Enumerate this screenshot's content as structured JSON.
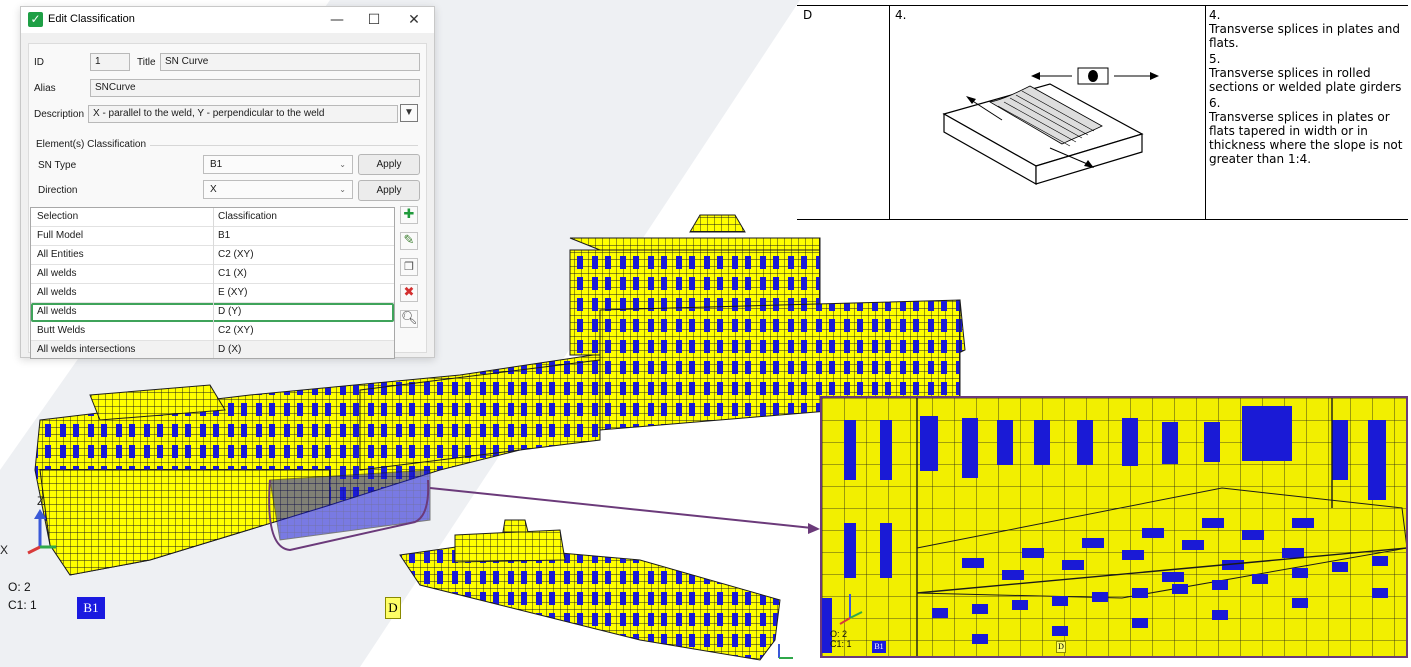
{
  "dialog": {
    "title": "Edit Classification",
    "controls": {
      "minimize": "—",
      "maximize": "☐",
      "close": "✕"
    },
    "id_label": "ID",
    "id_value": "1",
    "title_label": "Title",
    "title_value": "SN Curve",
    "alias_label": "Alias",
    "alias_value": "SNCurve",
    "description_label": "Description",
    "description_value": "X - parallel to the weld, Y - perpendicular to the weld",
    "section_title": "Element(s) Classification",
    "sn_type_label": "SN Type",
    "sn_type_value": "B1",
    "direction_label": "Direction",
    "direction_value": "X",
    "apply_label": "Apply",
    "table": {
      "headers": [
        "Selection",
        "Classification"
      ],
      "rows": [
        {
          "selection": "Full Model",
          "classification": "B1"
        },
        {
          "selection": "All Entities",
          "classification": "C2 (XY)"
        },
        {
          "selection": "All welds",
          "classification": "C1 (X)"
        },
        {
          "selection": "All welds",
          "classification": "E (XY)"
        },
        {
          "selection": "All welds",
          "classification": "D (Y)"
        },
        {
          "selection": "Butt Welds",
          "classification": "C2 (XY)"
        },
        {
          "selection": "All welds intersections",
          "classification": "D (X)"
        }
      ]
    },
    "tools": [
      "add-icon",
      "edit-icon",
      "copy-icon",
      "delete-icon",
      "zoom-icon"
    ]
  },
  "standard_table": {
    "col1": "D",
    "col2": "4.",
    "items": [
      {
        "num": "4.",
        "text": "Transverse splices in plates and flats."
      },
      {
        "num": "5.",
        "text": "Transverse splices in rolled sections or welded plate girders"
      },
      {
        "num": "6.",
        "text": "Transverse splices in plates or flats tapered in width or in thickness where the slope is not greater than 1:4."
      }
    ]
  },
  "viewport": {
    "axis_z": "Z",
    "axis_x": "X",
    "axis_y": "Y",
    "status_o": "O: 2",
    "status_c1": "C1: 1",
    "tag_b1": "B1",
    "tag_d": "D",
    "zoom_status_o": "O: 2",
    "zoom_status_c1": "C1: 1",
    "zoom_tag_b1": "B1",
    "zoom_tag_d": "D"
  },
  "colors": {
    "mesh_yellow": "#ffff00",
    "mesh_blue": "#1a1ad6",
    "accent_green": "#3fa35a",
    "callout_purple": "#6b3a7a"
  }
}
